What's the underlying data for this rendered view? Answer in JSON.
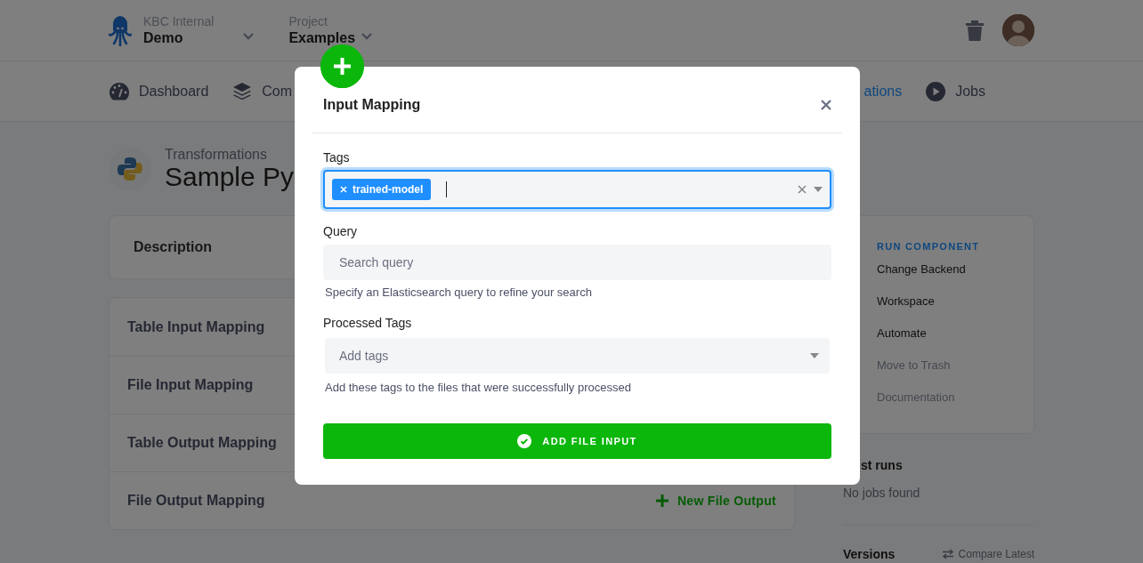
{
  "header": {
    "org_label": "KBC Internal",
    "org_name": "Demo",
    "project_label": "Project",
    "project_name": "Examples"
  },
  "nav": {
    "left": [
      {
        "label": "Dashboard",
        "selected": false
      },
      {
        "label": "Com",
        "selected": false
      }
    ],
    "right": [
      {
        "label": "ations",
        "selected": true
      },
      {
        "label": "Jobs",
        "selected": false
      }
    ]
  },
  "breadcrumb": {
    "parent": "Transformations",
    "title": "Sample Py"
  },
  "description": {
    "title": "Description"
  },
  "mappings": [
    {
      "title": "Table Input Mapping"
    },
    {
      "title": "File Input Mapping"
    },
    {
      "title": "Table Output Mapping"
    },
    {
      "title": "File Output Mapping",
      "action": "New File Output"
    }
  ],
  "sidebar": {
    "heading": "RUN COMPONENT",
    "items": [
      {
        "label": "Change Backend",
        "disabled": false
      },
      {
        "label": "Workspace",
        "disabled": false
      },
      {
        "label": "Automate",
        "disabled": false
      },
      {
        "label": "Move to Trash",
        "disabled": true
      },
      {
        "label": "Documentation",
        "disabled": true
      }
    ]
  },
  "last_runs": {
    "title": "st runs",
    "empty": "No jobs found"
  },
  "versions": {
    "title": "Versions",
    "action": "Compare Latest"
  },
  "modal": {
    "title": "Input Mapping",
    "fields": [
      {
        "kind": "tags",
        "label": "Tags",
        "tags": [
          "trained-model"
        ],
        "focused": true
      },
      {
        "kind": "text",
        "label": "Query",
        "placeholder": "Search query",
        "help": "Specify an Elasticsearch query to refine your search"
      },
      {
        "kind": "select",
        "label": "Processed Tags",
        "placeholder": "Add tags",
        "help": "Add these tags to the files that were successfully processed"
      }
    ],
    "submit": "ADD FILE INPUT"
  }
}
